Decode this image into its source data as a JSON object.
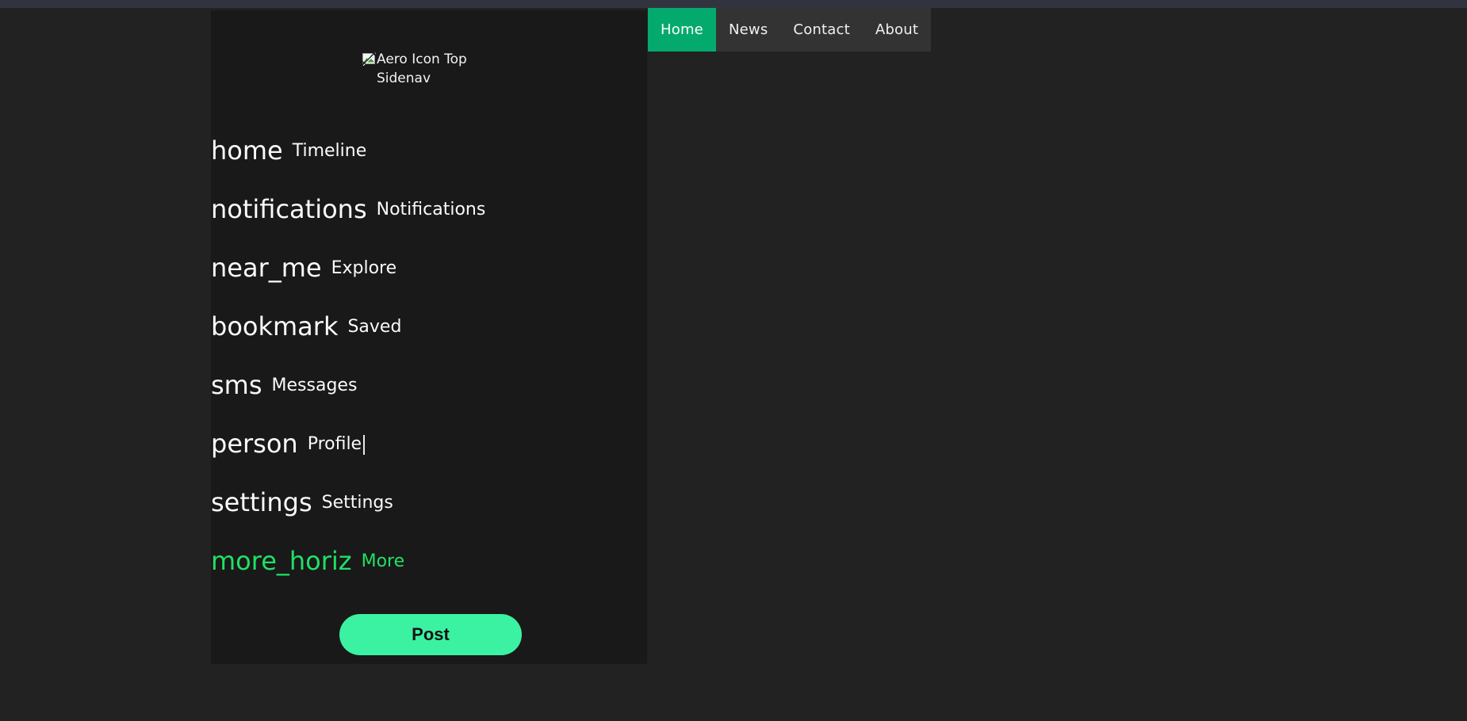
{
  "page": {
    "background_color": "#222222",
    "top_strip_color": "#31343f"
  },
  "topnav": {
    "background_color": "#333333",
    "active_color": "#04aa6d",
    "items": [
      {
        "label": "Home",
        "active": true
      },
      {
        "label": "News",
        "active": false
      },
      {
        "label": "Contact",
        "active": false
      },
      {
        "label": "About",
        "active": false
      }
    ]
  },
  "sidenav": {
    "background_color": "#191919",
    "logo": {
      "icon": "broken-image-icon",
      "alt_text": "Aero Icon Top Sidenav"
    },
    "hover_color": "#21e065",
    "items": [
      {
        "icon_name": "home",
        "icon_text": "home",
        "label": "Timeline",
        "state": "normal"
      },
      {
        "icon_name": "notifications",
        "icon_text": "notifications",
        "label": "Notifications",
        "state": "normal"
      },
      {
        "icon_name": "near_me",
        "icon_text": "near_me",
        "label": "Explore",
        "state": "normal"
      },
      {
        "icon_name": "bookmark",
        "icon_text": "bookmark",
        "label": "Saved",
        "state": "normal"
      },
      {
        "icon_name": "sms",
        "icon_text": "sms",
        "label": "Messages",
        "state": "normal"
      },
      {
        "icon_name": "person",
        "icon_text": "person",
        "label": "Profile",
        "state": "caret"
      },
      {
        "icon_name": "settings",
        "icon_text": "settings",
        "label": "Settings",
        "state": "normal"
      },
      {
        "icon_name": "more_horiz",
        "icon_text": "more_horiz",
        "label": "More",
        "state": "hovered"
      }
    ],
    "post_button": {
      "label": "Post",
      "color": "#3bf2a2",
      "text_color": "#131313"
    }
  }
}
